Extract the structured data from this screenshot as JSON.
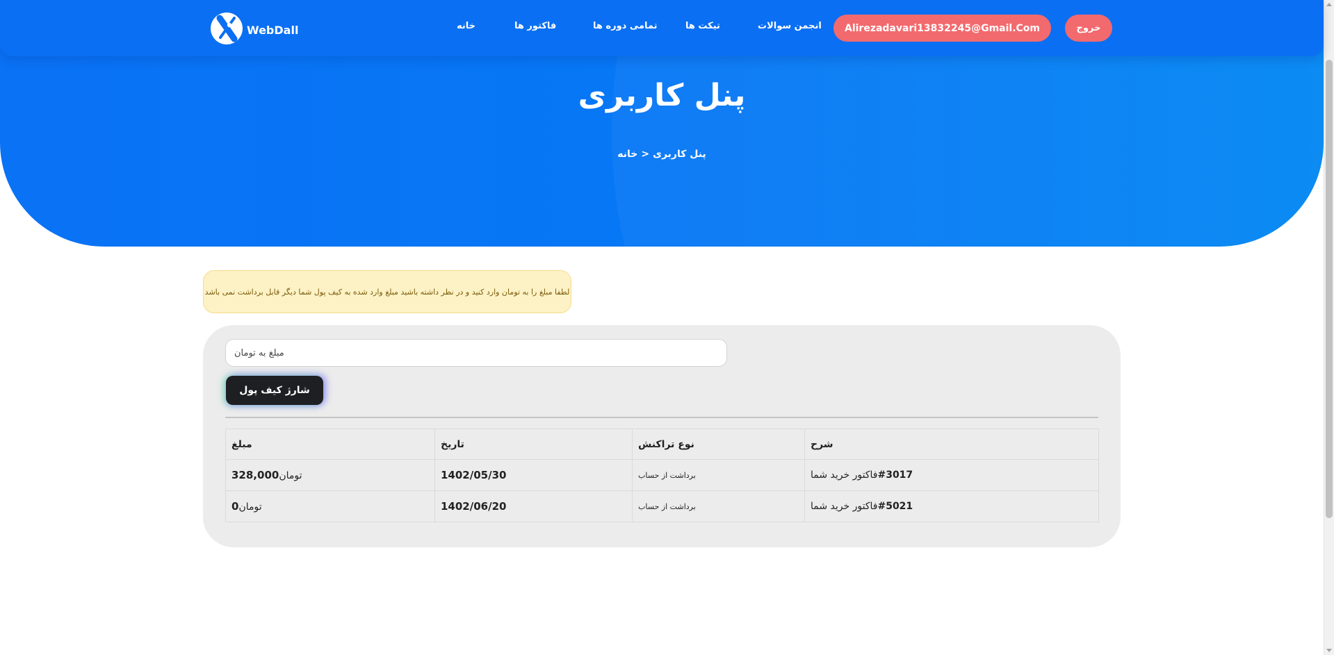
{
  "brand": {
    "name": "WebDall",
    "logo_icon": "webdall-x-logo-icon"
  },
  "nav": {
    "links": [
      {
        "label": "خانه"
      },
      {
        "label": "فاکتور ها"
      },
      {
        "label": "تمامی دوره ها"
      },
      {
        "label": "تیکت ها"
      },
      {
        "label": "انجمن سوالات"
      }
    ],
    "user_email": "Alirezadavari13832245@Gmail.Com",
    "logout_label": "خروج"
  },
  "hero": {
    "title": "پنل کاربری",
    "breadcrumb": {
      "current": "پنل کاربری",
      "separator": "<",
      "home": "خانه"
    }
  },
  "alert": {
    "text": "لطفا مبلغ را به تومان وارد کنید و در نظر داشته باشید مبلغ وارد شده به کیف پول شما دیگر قابل برداشت نمی باشد"
  },
  "wallet": {
    "amount_placeholder": "مبلغ به تومان",
    "amount_value": "",
    "charge_button_label": "شارژ کیف پول"
  },
  "transactions": {
    "headers": {
      "amount": "مبلغ",
      "date": "تاریخ",
      "type": "نوع تراکنش",
      "description": "شرح"
    },
    "rows": [
      {
        "description_text": "فاکتور خرید شما",
        "description_number": "#3017",
        "type": "برداشت از حساب",
        "date": "1402/05/30",
        "amount": "328,000",
        "currency": "تومان"
      },
      {
        "description_text": "فاکتور خرید شما",
        "description_number": "#5021",
        "type": "برداشت از حساب",
        "date": "1402/06/20",
        "amount": "0",
        "currency": "تومان"
      }
    ]
  },
  "colors": {
    "primary_blue": "#0a6ff3",
    "accent_coral": "#f26a6e",
    "alert_bg": "#fdf2c5",
    "card_bg": "#ececec",
    "debit_red": "#d92b2b",
    "button_dark": "#1e1f22"
  }
}
